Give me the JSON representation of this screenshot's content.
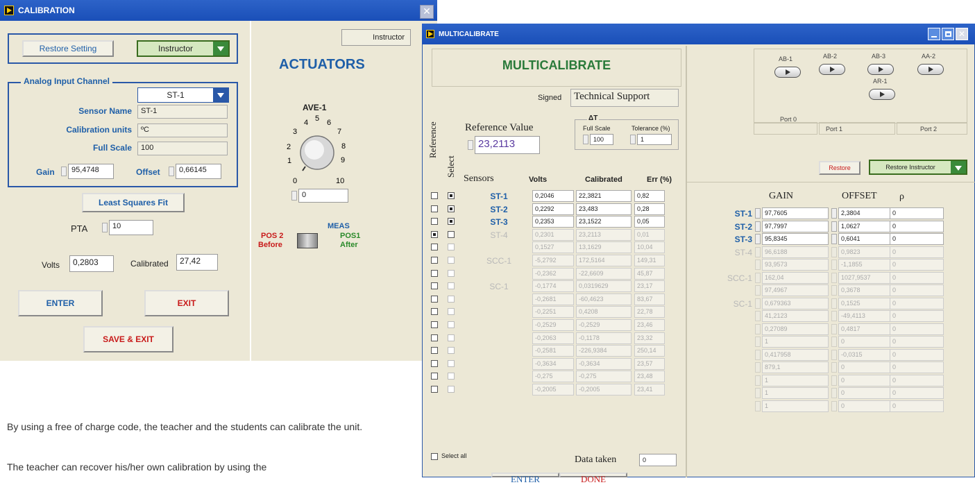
{
  "calibration": {
    "title": "CALIBRATION",
    "restore_label": "Restore Setting",
    "user_select": "Instructor",
    "analog_title": "Analog Input Channel",
    "channel_select": "ST-1",
    "sensor_name_label": "Sensor Name",
    "sensor_name_value": "ST-1",
    "units_label": "Calibration units",
    "units_value": "ºC",
    "fullscale_label": "Full Scale",
    "fullscale_value": "100",
    "gain_label": "Gain",
    "gain_value": "95,4748",
    "offset_label": "Offset",
    "offset_value": "0,66145",
    "lsq_label": "Least Squares Fit",
    "pta_label": "PTA",
    "pta_value": "10",
    "volts_label": "Volts",
    "volts_value": "0,2803",
    "calibrated_label": "Calibrated",
    "calibrated_value": "27,42",
    "enter_label": "ENTER",
    "exit_label": "EXIT",
    "save_exit_label": "SAVE & EXIT",
    "right_badge": "Instructor",
    "actuators_label": "ACTUATORS",
    "valve_label": "AVE-1",
    "dial_ticks": [
      "0",
      "1",
      "2",
      "3",
      "4",
      "5",
      "6",
      "7",
      "8",
      "9",
      "10"
    ],
    "dial_value": "0",
    "meas_label": "MEAS",
    "pos2_label": "POS 2",
    "before_label": "Before",
    "pos1_label": "POS1",
    "after_label": "After"
  },
  "caption": {
    "para1": "By using a free of charge code, the teacher and the students can calibrate the unit.",
    "para2": "The teacher can recover his/her own calibration by using the"
  },
  "multi": {
    "title": "MULTICALIBRATE",
    "heading": "MULTICALIBRATE",
    "signed_label": "Signed",
    "signed_value": "Technical Support",
    "ref_value_label": "Reference Value",
    "ref_value": "23,2113",
    "at_label": "ΔT",
    "full_scale_label": "Full Scale",
    "full_scale_value": "100",
    "tolerance_label": "Tolerance (%)",
    "tolerance_value": "1",
    "reference_col": "Reference",
    "select_col": "Select",
    "col_sensors": "Sensors",
    "col_volts": "Volts",
    "col_calibrated": "Calibrated",
    "col_err": "Err (%)",
    "rows": [
      {
        "ref": false,
        "sel": true,
        "active": true,
        "sensor": "ST-1",
        "volts": "0,2046",
        "cal": "22,3821",
        "err": "0,82"
      },
      {
        "ref": false,
        "sel": true,
        "active": true,
        "sensor": "ST-2",
        "volts": "0,2292",
        "cal": "23,483",
        "err": "0,28"
      },
      {
        "ref": false,
        "sel": true,
        "active": true,
        "sensor": "ST-3",
        "volts": "0,2353",
        "cal": "23,1522",
        "err": "0,05"
      },
      {
        "ref": true,
        "sel": false,
        "active": false,
        "sensor": "ST-4",
        "volts": "0,2301",
        "cal": "23,2113",
        "err": "0,01"
      },
      {
        "ref": false,
        "sel": false,
        "active": false,
        "sensor": "",
        "volts": "0,1527",
        "cal": "13,1629",
        "err": "10,04"
      },
      {
        "ref": false,
        "sel": false,
        "active": false,
        "sensor": "SCC-1",
        "volts": "-5,2792",
        "cal": "172,5164",
        "err": "149,31"
      },
      {
        "ref": false,
        "sel": false,
        "active": false,
        "sensor": "",
        "volts": "-0,2362",
        "cal": "-22,6609",
        "err": "45,87"
      },
      {
        "ref": false,
        "sel": false,
        "active": false,
        "sensor": "SC-1",
        "volts": "-0,1774",
        "cal": "0,0319629",
        "err": "23,17"
      },
      {
        "ref": false,
        "sel": false,
        "active": false,
        "sensor": "",
        "volts": "-0,2681",
        "cal": "-60,4623",
        "err": "83,67"
      },
      {
        "ref": false,
        "sel": false,
        "active": false,
        "sensor": "",
        "volts": "-0,2251",
        "cal": "0,4208",
        "err": "22,78"
      },
      {
        "ref": false,
        "sel": false,
        "active": false,
        "sensor": "",
        "volts": "-0,2529",
        "cal": "-0,2529",
        "err": "23,46"
      },
      {
        "ref": false,
        "sel": false,
        "active": false,
        "sensor": "",
        "volts": "-0,2063",
        "cal": "-0,1178",
        "err": "23,32"
      },
      {
        "ref": false,
        "sel": false,
        "active": false,
        "sensor": "",
        "volts": "-0,2581",
        "cal": "-226,9384",
        "err": "250,14"
      },
      {
        "ref": false,
        "sel": false,
        "active": false,
        "sensor": "",
        "volts": "-0,3634",
        "cal": "-0,3634",
        "err": "23,57"
      },
      {
        "ref": false,
        "sel": false,
        "active": false,
        "sensor": "",
        "volts": "-0,275",
        "cal": "-0,275",
        "err": "23,48"
      },
      {
        "ref": false,
        "sel": false,
        "active": false,
        "sensor": "",
        "volts": "-0,2005",
        "cal": "-0,2005",
        "err": "23,41"
      }
    ],
    "select_all_label": "Select all",
    "data_taken_label": "Data taken",
    "data_taken_value": "0",
    "enter_label": "ENTER",
    "done_label": "DONE",
    "switches": [
      "AB-1",
      "AB-2",
      "AB-3",
      "AA-2",
      "AR-1"
    ],
    "ports": [
      "Port 0",
      "Port 1",
      "Port 2"
    ],
    "restore_label": "Restore",
    "restore_instructor": "Restore Instructor",
    "gain_col": "GAIN",
    "offset_col": "OFFSET",
    "rho_col": "ρ",
    "grows": [
      {
        "active": true,
        "sensor": "ST-1",
        "gain": "97,7605",
        "offset": "2,3804",
        "rho": "0"
      },
      {
        "active": true,
        "sensor": "ST-2",
        "gain": "97,7997",
        "offset": "1,0627",
        "rho": "0"
      },
      {
        "active": true,
        "sensor": "ST-3",
        "gain": "95,8345",
        "offset": "0,6041",
        "rho": "0"
      },
      {
        "active": false,
        "sensor": "ST-4",
        "gain": "96,6188",
        "offset": "0,9823",
        "rho": "0"
      },
      {
        "active": false,
        "sensor": "",
        "gain": "93,9573",
        "offset": "-1,1855",
        "rho": "0"
      },
      {
        "active": false,
        "sensor": "SCC-1",
        "gain": "162,04",
        "offset": "1027,9537",
        "rho": "0"
      },
      {
        "active": false,
        "sensor": "",
        "gain": "97,4967",
        "offset": "0,3678",
        "rho": "0"
      },
      {
        "active": false,
        "sensor": "SC-1",
        "gain": "0,679363",
        "offset": "0,1525",
        "rho": "0"
      },
      {
        "active": false,
        "sensor": "",
        "gain": "41,2123",
        "offset": "-49,4113",
        "rho": "0"
      },
      {
        "active": false,
        "sensor": "",
        "gain": "0,27089",
        "offset": "0,4817",
        "rho": "0"
      },
      {
        "active": false,
        "sensor": "",
        "gain": "1",
        "offset": "0",
        "rho": "0"
      },
      {
        "active": false,
        "sensor": "",
        "gain": "0,417958",
        "offset": "-0,0315",
        "rho": "0"
      },
      {
        "active": false,
        "sensor": "",
        "gain": "879,1",
        "offset": "0",
        "rho": "0"
      },
      {
        "active": false,
        "sensor": "",
        "gain": "1",
        "offset": "0",
        "rho": "0"
      },
      {
        "active": false,
        "sensor": "",
        "gain": "1",
        "offset": "0",
        "rho": "0"
      },
      {
        "active": false,
        "sensor": "",
        "gain": "1",
        "offset": "0",
        "rho": "0"
      }
    ]
  }
}
